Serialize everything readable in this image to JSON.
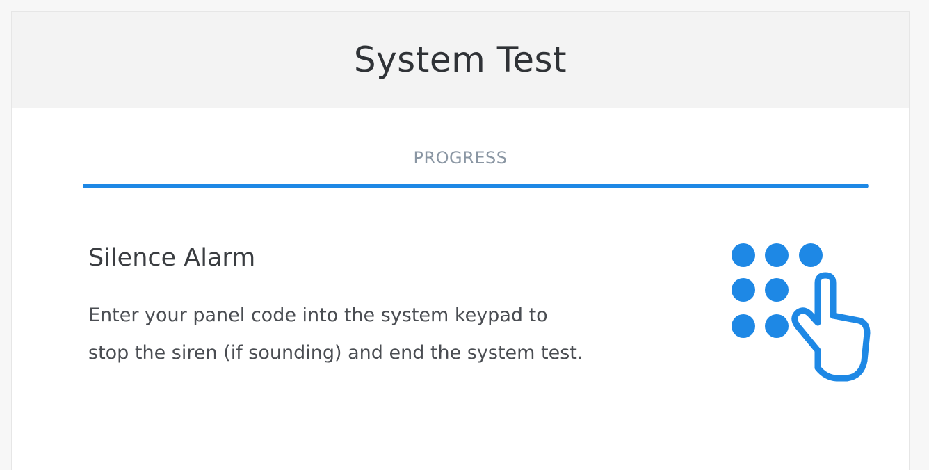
{
  "header": {
    "title": "System Test"
  },
  "progress": {
    "label": "PROGRESS",
    "value_percent": 100,
    "color": "#1e88e5"
  },
  "step": {
    "title": "Silence Alarm",
    "description": "Enter your panel code into the system keypad to stop the siren (if sounding) and end the system test.",
    "icon": "keypad-touch-icon",
    "icon_color": "#1e88e5"
  }
}
